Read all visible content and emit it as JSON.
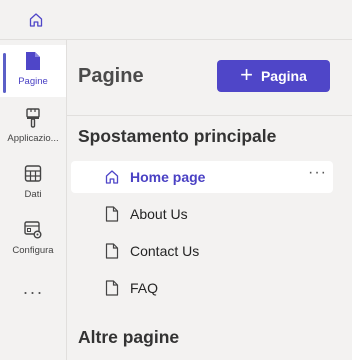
{
  "topbar": {
    "home_icon": "home-icon"
  },
  "rail": {
    "items": [
      {
        "label": "Pagine",
        "icon": "page-icon",
        "active": true
      },
      {
        "label": "Applicazio...",
        "icon": "brush-icon",
        "active": false
      },
      {
        "label": "Dati",
        "icon": "table-icon",
        "active": false
      },
      {
        "label": "Configura",
        "icon": "settings-icon",
        "active": false
      }
    ],
    "more_label": "···"
  },
  "panel": {
    "title": "Pagine",
    "new_button_label": "Pagina",
    "main_nav_title": "Spostamento principale",
    "nav_items": [
      {
        "label": "Home page",
        "icon": "home-icon",
        "selected": true,
        "more": "···"
      },
      {
        "label": "About Us",
        "icon": "page-icon",
        "selected": false
      },
      {
        "label": "Contact Us",
        "icon": "page-icon",
        "selected": false
      },
      {
        "label": "FAQ",
        "icon": "page-icon",
        "selected": false
      }
    ],
    "other_pages_title": "Altre pagine"
  },
  "colors": {
    "accent": "#4f46c8",
    "selected_text": "#4a41c4"
  }
}
